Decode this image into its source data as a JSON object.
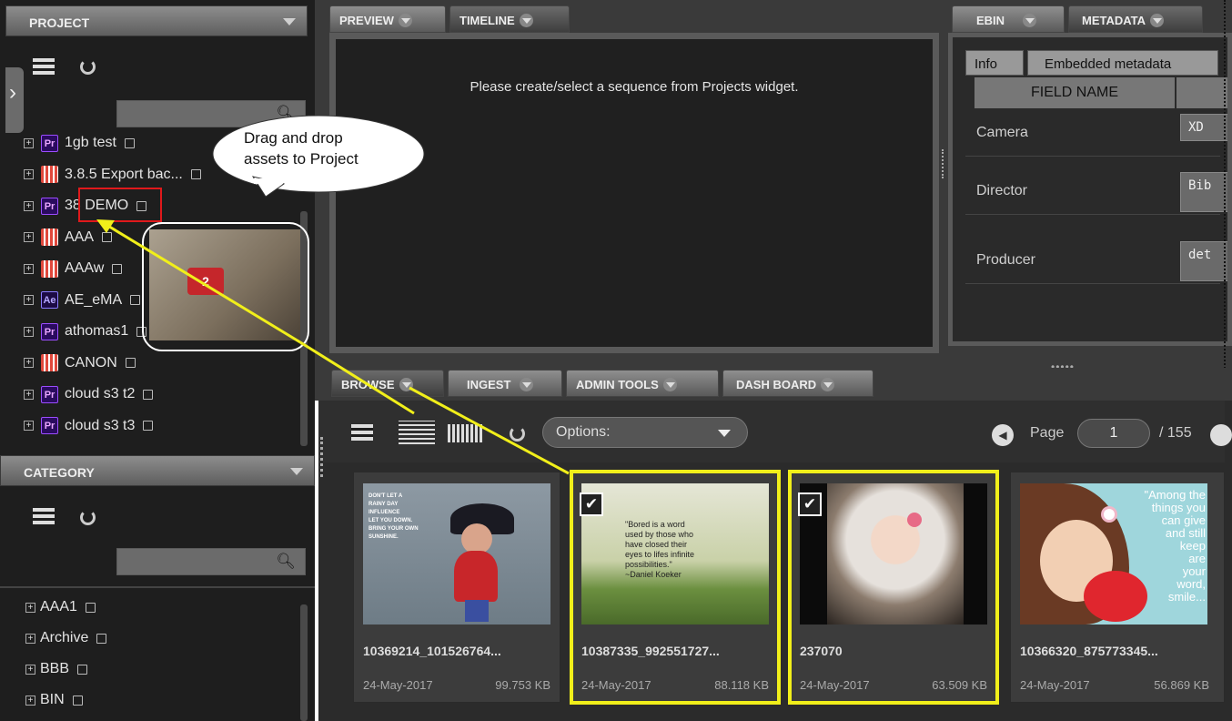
{
  "project_panel": {
    "title": "PROJECT",
    "items": [
      {
        "label": "1gb test",
        "icon": "pr"
      },
      {
        "label": "3.8.5 Export bac...",
        "icon": "film"
      },
      {
        "label": "38 DEMO",
        "icon": "pr"
      },
      {
        "label": "AAA",
        "icon": "film"
      },
      {
        "label": "AAAw",
        "icon": "film"
      },
      {
        "label": "AE_eMA",
        "icon": "ae"
      },
      {
        "label": "athomas1",
        "icon": "pr"
      },
      {
        "label": "CANON",
        "icon": "film"
      },
      {
        "label": "cloud s3 t2",
        "icon": "pr"
      },
      {
        "label": "cloud s3 t3",
        "icon": "pr"
      }
    ]
  },
  "category_panel": {
    "title": "CATEGORY",
    "items": [
      "AAA1",
      "Archive",
      "BBB",
      "BIN"
    ]
  },
  "icons": {
    "pr": "Pr",
    "ae": "Ae",
    "search": "search-icon",
    "grid": "grid-icon",
    "refresh": "refresh-icon"
  },
  "callout": {
    "text_line1": "Drag and drop",
    "text_line2": "assets to Project"
  },
  "drag_count": "2",
  "top_tabs": {
    "preview": "PREVIEW",
    "timeline": "TIMELINE",
    "ebin": "EBIN",
    "metadata": "METADATA"
  },
  "preview_message": "Please create/select a sequence from Projects widget.",
  "metadata": {
    "tab_info": "Info",
    "tab_embedded": "Embedded metadata",
    "header": "FIELD NAME",
    "rows": [
      {
        "field": "Camera",
        "value": "XD"
      },
      {
        "field": "Director",
        "value": "Bib"
      },
      {
        "field": "Producer",
        "value": "det"
      }
    ]
  },
  "bottom_tabs": {
    "browse": "BROWSE",
    "ingest": "INGEST",
    "admin": "ADMIN TOOLS",
    "dash": "DASH BOARD"
  },
  "toolbar": {
    "options_label": "Options:",
    "page_label": "Page",
    "page_value": "1",
    "page_total": "/ 155"
  },
  "assets": [
    {
      "name": "10369214_101526764...",
      "date": "24-May-2017",
      "size": "99.753 KB",
      "selected": false,
      "quote": [
        "DON'T LET A",
        "RAINY DAY",
        "INFLUENCE",
        "LET YOU DOWN.",
        "BRING YOUR OWN",
        "SUNSHINE."
      ]
    },
    {
      "name": "10387335_992551727...",
      "date": "24-May-2017",
      "size": "88.118 KB",
      "selected": true,
      "quote": [
        "\"Bored is a word",
        "used by those who",
        "have closed their",
        "eyes to lifes infinite",
        "possibilities.\"",
        "~Daniel Koeker"
      ]
    },
    {
      "name": "237070",
      "date": "24-May-2017",
      "size": "63.509 KB",
      "selected": true
    },
    {
      "name": "10366320_875773345...",
      "date": "24-May-2017",
      "size": "56.869 KB",
      "selected": false,
      "quote": [
        "\"Among the",
        "things you",
        "can give",
        "and still",
        "keep",
        "are",
        "your",
        "word,",
        "smile..."
      ]
    }
  ]
}
